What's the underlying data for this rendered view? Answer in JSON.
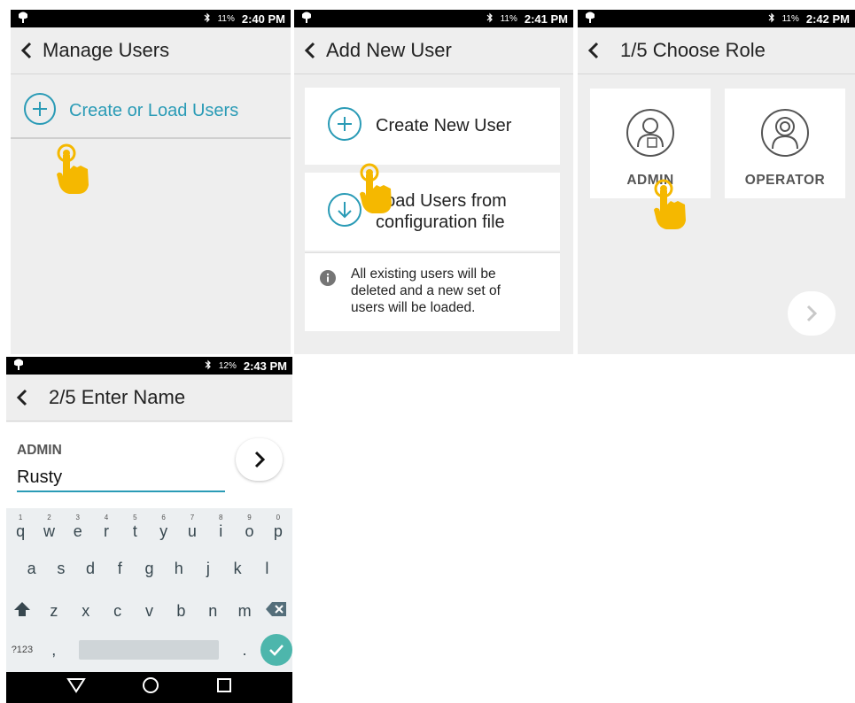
{
  "colors": {
    "accent": "#2a9bb6",
    "hand": "#f5b800",
    "confirm": "#4db6ac"
  },
  "panels": [
    {
      "status": {
        "battery": "11%",
        "time": "2:40 PM"
      },
      "title": "Manage Users",
      "items": [
        {
          "label": "Create or Load Users",
          "icon": "plus-circle-icon"
        }
      ]
    },
    {
      "status": {
        "battery": "11%",
        "time": "2:41 PM"
      },
      "title": "Add New User",
      "options": [
        {
          "label": "Create New User",
          "icon": "plus-circle-icon"
        },
        {
          "label_line1": "Load Users from",
          "label_line2": "configuration file",
          "icon": "download-circle-icon"
        }
      ],
      "info": {
        "line1": "All existing users will be",
        "line2": "deleted and a new set of",
        "line3": "users will be loaded."
      }
    },
    {
      "status": {
        "battery": "11%",
        "time": "2:42 PM"
      },
      "title": "1/5 Choose Role",
      "roles": [
        {
          "label": "ADMIN"
        },
        {
          "label": "OPERATOR"
        }
      ]
    },
    {
      "status": {
        "battery": "12%",
        "time": "2:43 PM"
      },
      "title": "2/5 Enter Name",
      "field_label": "ADMIN",
      "field_value": "Rusty",
      "keyboard": {
        "row1": [
          {
            "key": "q",
            "hint": "1"
          },
          {
            "key": "w",
            "hint": "2"
          },
          {
            "key": "e",
            "hint": "3"
          },
          {
            "key": "r",
            "hint": "4"
          },
          {
            "key": "t",
            "hint": "5"
          },
          {
            "key": "y",
            "hint": "6"
          },
          {
            "key": "u",
            "hint": "7"
          },
          {
            "key": "i",
            "hint": "8"
          },
          {
            "key": "o",
            "hint": "9"
          },
          {
            "key": "p",
            "hint": "0"
          }
        ],
        "row2": [
          "a",
          "s",
          "d",
          "f",
          "g",
          "h",
          "j",
          "k",
          "l"
        ],
        "row3": [
          "z",
          "x",
          "c",
          "v",
          "b",
          "n",
          "m"
        ],
        "symbols_label": "?123",
        "comma": ",",
        "period": "."
      }
    }
  ]
}
